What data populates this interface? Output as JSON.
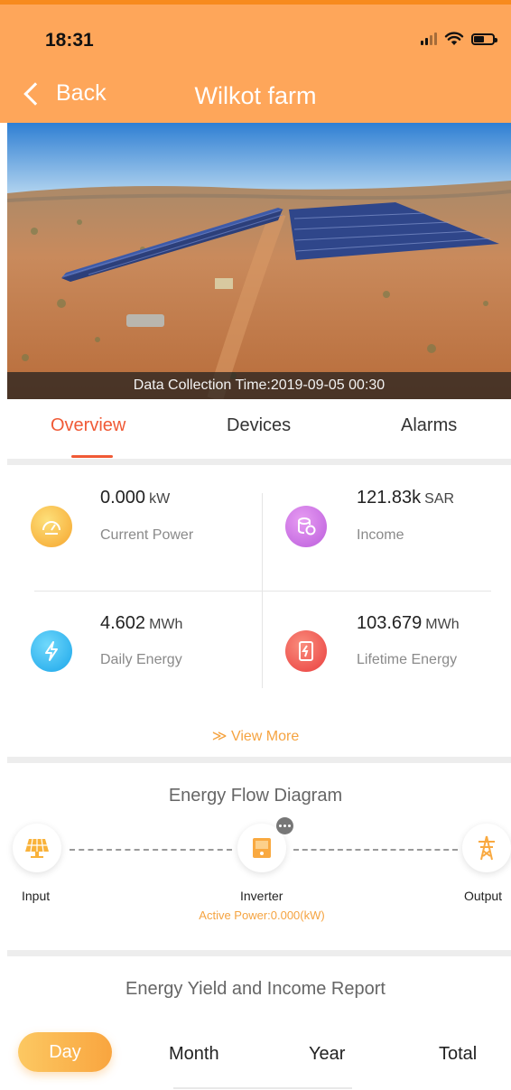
{
  "status_bar": {
    "time": "18:31"
  },
  "header": {
    "back_label": "Back",
    "title": "Wilkot farm"
  },
  "photo": {
    "caption": "Data Collection Time:2019-09-05 00:30"
  },
  "tabs": [
    {
      "label": "Overview",
      "active": true
    },
    {
      "label": "Devices",
      "active": false
    },
    {
      "label": "Alarms",
      "active": false
    }
  ],
  "kpis": {
    "current_power": {
      "value": "0.000",
      "unit": "kW",
      "label": "Current Power",
      "icon": "gauge-icon",
      "color": "#f9b23a"
    },
    "income": {
      "value": "121.83k",
      "unit": "SAR",
      "label": "Income",
      "icon": "coins-icon",
      "color": "#c065e0"
    },
    "daily_energy": {
      "value": "4.602",
      "unit": "MWh",
      "label": "Daily Energy",
      "icon": "lightning-icon",
      "color": "#2cb6f0"
    },
    "lifetime_energy": {
      "value": "103.679",
      "unit": "MWh",
      "label": "Lifetime Energy",
      "icon": "battery-bolt-icon",
      "color": "#ef4f47"
    }
  },
  "view_more": "≫ View More",
  "energy_flow": {
    "title": "Energy Flow Diagram",
    "input_label": "Input",
    "inverter_label": "Inverter",
    "output_label": "Output",
    "active_power": "Active Power:0.000(kW)"
  },
  "report": {
    "title": "Energy Yield and Income Report",
    "periods": [
      {
        "label": "Day",
        "active": true
      },
      {
        "label": "Month",
        "active": false
      },
      {
        "label": "Year",
        "active": false
      },
      {
        "label": "Total",
        "active": false
      }
    ]
  },
  "colors": {
    "header": "#fea65a",
    "accent": "#f05a36",
    "highlight": "#f5a340"
  }
}
